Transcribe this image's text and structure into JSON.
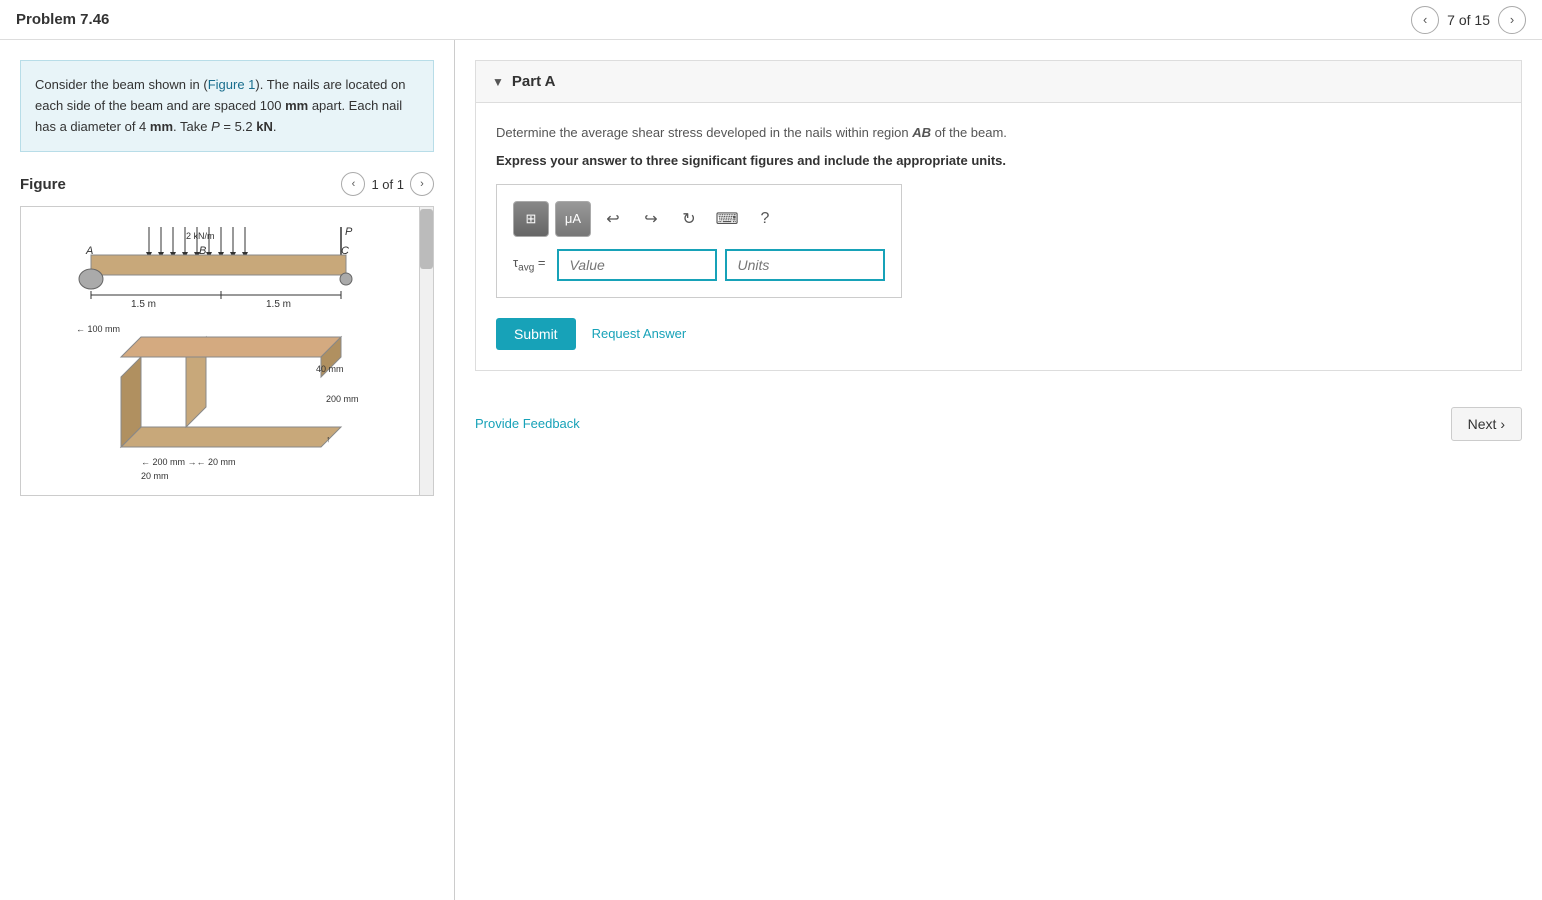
{
  "header": {
    "title": "Problem 7.46",
    "page_current": 7,
    "page_total": 15,
    "page_label": "7 of 15",
    "prev_label": "‹",
    "next_label": "›"
  },
  "problem": {
    "text_part1": "Consider the beam shown in (",
    "figure_link": "Figure 1",
    "text_part2": "). The nails are located on each side of the beam and are spaced 100 ",
    "unit1": "mm",
    "text_part3": " apart. Each nail has a diameter of 4 ",
    "unit2": "mm",
    "text_part4": ". Take ",
    "variable": "P",
    "text_part5": " = 5.2 ",
    "unit3": "kN",
    "text_part6": "."
  },
  "figure": {
    "title": "Figure",
    "counter": "1 of 1"
  },
  "part_a": {
    "title": "Part A",
    "description": "Determine the average shear stress developed in the nails within region AB of the beam.",
    "instruction": "Express your answer to three significant figures and include the appropriate units.",
    "toolbar": {
      "btn1": "⊞",
      "btn2": "μA",
      "undo": "↩",
      "redo": "↪",
      "refresh": "↻",
      "keyboard": "⌨",
      "help": "?"
    },
    "input": {
      "label": "τ",
      "subscript": "avg",
      "equals": "=",
      "value_placeholder": "Value",
      "units_placeholder": "Units"
    },
    "submit_label": "Submit",
    "request_answer_label": "Request Answer",
    "feedback_label": "Provide Feedback",
    "next_label": "Next ›"
  }
}
